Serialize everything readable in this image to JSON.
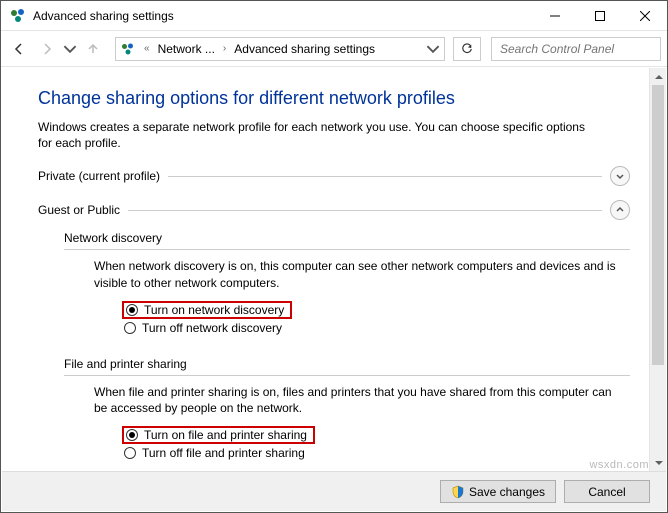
{
  "window": {
    "title": "Advanced sharing settings"
  },
  "breadcrumb": {
    "seg1": "Network ...",
    "seg2": "Advanced sharing settings"
  },
  "search": {
    "placeholder": "Search Control Panel"
  },
  "page": {
    "heading": "Change sharing options for different network profiles",
    "description": "Windows creates a separate network profile for each network you use. You can choose specific options for each profile."
  },
  "sections": {
    "private": {
      "label": "Private (current profile)"
    },
    "guest": {
      "label": "Guest or Public",
      "network_discovery": {
        "title": "Network discovery",
        "desc": "When network discovery is on, this computer can see other network computers and devices and is visible to other network computers.",
        "opt_on": "Turn on network discovery",
        "opt_off": "Turn off network discovery"
      },
      "file_printer": {
        "title": "File and printer sharing",
        "desc": "When file and printer sharing is on, files and printers that you have shared from this computer can be accessed by people on the network.",
        "opt_on": "Turn on file and printer sharing",
        "opt_off": "Turn off file and printer sharing"
      }
    }
  },
  "buttons": {
    "save": "Save changes",
    "cancel": "Cancel"
  },
  "watermark": "wsxdn.com"
}
